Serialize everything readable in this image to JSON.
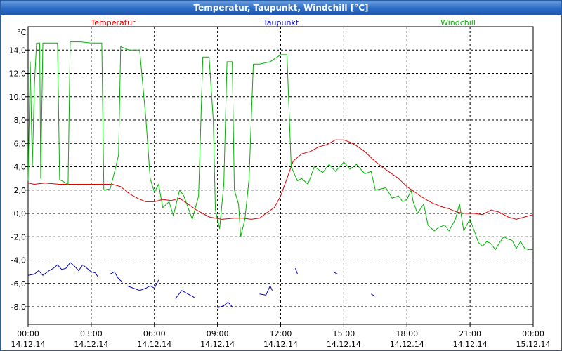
{
  "window": {
    "title": "Temperatur, Taupunkt, Windchill [°C]"
  },
  "colors": {
    "temperatur": "#e00000",
    "taupunkt": "#0000c0",
    "windchill": "#00b400",
    "grid": "#000000",
    "title_bar": "#2c6cc4"
  },
  "chart_data": {
    "type": "line",
    "title": "Temperatur, Taupunkt, Windchill [°C]",
    "unit_label": "°C",
    "ylim": [
      -9.5,
      16
    ],
    "xlim_hours": [
      0,
      24
    ],
    "grid": true,
    "legend_placement": "top",
    "y_ticks": [
      {
        "v": 14,
        "label": "14,0"
      },
      {
        "v": 12,
        "label": "12,0"
      },
      {
        "v": 10,
        "label": "10,0"
      },
      {
        "v": 8,
        "label": "8,0"
      },
      {
        "v": 6,
        "label": "6,0"
      },
      {
        "v": 4,
        "label": "4,0"
      },
      {
        "v": 2,
        "label": "2,0"
      },
      {
        "v": 0,
        "label": "0,0"
      },
      {
        "v": -2,
        "label": "-2,0"
      },
      {
        "v": -4,
        "label": "-4,0"
      },
      {
        "v": -6,
        "label": "-6,0"
      },
      {
        "v": -8,
        "label": "-8,0"
      }
    ],
    "x_ticks": [
      {
        "h": 0,
        "time": "00:00",
        "date": "14.12.14"
      },
      {
        "h": 3,
        "time": "03:00",
        "date": "14.12.14"
      },
      {
        "h": 6,
        "time": "06:00",
        "date": "14.12.14"
      },
      {
        "h": 9,
        "time": "09:00",
        "date": "14.12.14"
      },
      {
        "h": 12,
        "time": "12:00",
        "date": "14.12.14"
      },
      {
        "h": 15,
        "time": "15:00",
        "date": "14.12.14"
      },
      {
        "h": 18,
        "time": "18:00",
        "date": "14.12.14"
      },
      {
        "h": 21,
        "time": "21:00",
        "date": "14.12.14"
      },
      {
        "h": 24,
        "time": "00:00",
        "date": "15.12.14"
      }
    ],
    "series": [
      {
        "name": "Temperatur",
        "key": "temperatur",
        "segments": [
          [
            [
              0,
              2.6
            ],
            [
              0.3,
              2.5
            ],
            [
              0.8,
              2.6
            ],
            [
              1.5,
              2.5
            ],
            [
              2.5,
              2.5
            ],
            [
              3.5,
              2.5
            ],
            [
              4.0,
              2.5
            ],
            [
              4.4,
              2.3
            ],
            [
              4.8,
              1.7
            ],
            [
              5.2,
              1.3
            ],
            [
              5.6,
              1.0
            ],
            [
              6.0,
              1.0
            ],
            [
              6.4,
              1.2
            ],
            [
              6.8,
              1.1
            ],
            [
              7.2,
              1.3
            ],
            [
              7.6,
              0.8
            ],
            [
              8.0,
              0.3
            ],
            [
              8.6,
              -0.3
            ],
            [
              9.2,
              -0.5
            ],
            [
              9.8,
              -0.4
            ],
            [
              10.2,
              -0.4
            ],
            [
              10.6,
              -0.5
            ],
            [
              11.0,
              -0.4
            ],
            [
              11.3,
              0.0
            ],
            [
              11.7,
              0.5
            ],
            [
              12.0,
              1.5
            ],
            [
              12.3,
              3.0
            ],
            [
              12.6,
              4.5
            ],
            [
              13.0,
              5.1
            ],
            [
              13.4,
              5.3
            ],
            [
              13.8,
              5.7
            ],
            [
              14.2,
              5.9
            ],
            [
              14.6,
              6.3
            ],
            [
              15.0,
              6.3
            ],
            [
              15.3,
              6.1
            ],
            [
              15.6,
              5.8
            ],
            [
              16.0,
              5.3
            ],
            [
              16.4,
              4.6
            ],
            [
              16.8,
              4.0
            ],
            [
              17.2,
              3.5
            ],
            [
              17.6,
              3.0
            ],
            [
              18.0,
              2.3
            ],
            [
              18.4,
              1.8
            ],
            [
              18.8,
              1.3
            ],
            [
              19.2,
              0.9
            ],
            [
              19.6,
              0.6
            ],
            [
              20.0,
              0.4
            ],
            [
              20.4,
              0.1
            ],
            [
              20.8,
              0.0
            ],
            [
              21.2,
              0.0
            ],
            [
              21.6,
              -0.1
            ],
            [
              22.0,
              0.3
            ],
            [
              22.4,
              0.1
            ],
            [
              22.8,
              -0.3
            ],
            [
              23.2,
              -0.5
            ],
            [
              23.6,
              -0.3
            ],
            [
              24.0,
              -0.1
            ]
          ]
        ]
      },
      {
        "name": "Taupunkt",
        "key": "taupunkt",
        "segments": [
          [
            [
              0,
              -5.3
            ],
            [
              0.3,
              -5.2
            ],
            [
              0.5,
              -4.9
            ],
            [
              0.7,
              -5.3
            ],
            [
              1.0,
              -4.9
            ],
            [
              1.2,
              -4.7
            ],
            [
              1.4,
              -4.4
            ],
            [
              1.6,
              -4.8
            ],
            [
              1.8,
              -4.7
            ],
            [
              2.0,
              -4.2
            ],
            [
              2.2,
              -4.5
            ],
            [
              2.4,
              -4.9
            ],
            [
              2.6,
              -4.4
            ],
            [
              2.8,
              -4.7
            ],
            [
              3.0,
              -5.0
            ],
            [
              3.2,
              -5.1
            ],
            [
              3.3,
              -5.4
            ]
          ],
          [
            [
              3.9,
              -5.2
            ],
            [
              4.1,
              -5.0
            ],
            [
              4.3,
              -5.6
            ],
            [
              4.5,
              -5.9
            ]
          ],
          [
            [
              4.7,
              -6.2
            ],
            [
              5.0,
              -6.4
            ],
            [
              5.3,
              -6.6
            ],
            [
              5.6,
              -6.4
            ],
            [
              5.8,
              -6.2
            ],
            [
              6.0,
              -6.4
            ],
            [
              6.2,
              -5.7
            ]
          ],
          [
            [
              7.0,
              -7.3
            ],
            [
              7.3,
              -6.6
            ],
            [
              7.6,
              -6.9
            ],
            [
              7.9,
              -7.2
            ]
          ],
          [
            [
              9.0,
              -8.1
            ],
            [
              9.3,
              -7.9
            ],
            [
              9.5,
              -7.6
            ],
            [
              9.7,
              -8.0
            ]
          ],
          [
            [
              11.0,
              -6.9
            ],
            [
              11.3,
              -7.0
            ],
            [
              11.5,
              -6.2
            ],
            [
              11.6,
              -6.6
            ]
          ],
          [
            [
              12.7,
              -4.7
            ],
            [
              12.8,
              -5.2
            ]
          ],
          [
            [
              14.5,
              -5.0
            ],
            [
              14.7,
              -5.2
            ]
          ],
          [
            [
              16.3,
              -6.9
            ],
            [
              16.5,
              -7.1
            ]
          ]
        ]
      },
      {
        "name": "Windchill",
        "key": "windchill",
        "segments": [
          [
            [
              0,
              2.8
            ],
            [
              0.1,
              13.0
            ],
            [
              0.2,
              4.0
            ],
            [
              0.3,
              11.0
            ],
            [
              0.4,
              14.6
            ],
            [
              0.55,
              14.6
            ],
            [
              0.6,
              3.0
            ],
            [
              0.7,
              14.6
            ],
            [
              1.4,
              14.6
            ],
            [
              1.5,
              2.9
            ],
            [
              1.9,
              2.5
            ],
            [
              2.0,
              14.7
            ],
            [
              2.5,
              14.7
            ],
            [
              3.0,
              14.6
            ],
            [
              3.5,
              14.6
            ],
            [
              3.6,
              2.0
            ],
            [
              3.9,
              2.1
            ],
            [
              4.1,
              3.5
            ],
            [
              4.3,
              5.0
            ],
            [
              4.4,
              14.3
            ],
            [
              4.8,
              14.0
            ],
            [
              5.3,
              14.0
            ],
            [
              5.6,
              8.0
            ],
            [
              5.8,
              3.0
            ],
            [
              6.0,
              1.8
            ],
            [
              6.2,
              2.5
            ],
            [
              6.4,
              0.5
            ],
            [
              6.7,
              1.0
            ],
            [
              6.9,
              -0.2
            ],
            [
              7.2,
              2.0
            ],
            [
              7.4,
              1.5
            ],
            [
              7.6,
              0.5
            ],
            [
              7.8,
              -0.5
            ],
            [
              8.1,
              1.5
            ],
            [
              8.3,
              13.4
            ],
            [
              8.6,
              13.4
            ],
            [
              8.8,
              8.0
            ],
            [
              8.9,
              0.3
            ],
            [
              9.1,
              -1.3
            ],
            [
              9.3,
              2.5
            ],
            [
              9.45,
              13.0
            ],
            [
              9.7,
              13.0
            ],
            [
              9.8,
              2.0
            ],
            [
              10.0,
              0.8
            ],
            [
              10.1,
              -2.0
            ],
            [
              10.3,
              -0.5
            ],
            [
              10.5,
              3.0
            ],
            [
              10.7,
              12.8
            ],
            [
              11.0,
              12.8
            ],
            [
              11.5,
              13.0
            ],
            [
              12.0,
              13.6
            ],
            [
              12.3,
              13.6
            ],
            [
              12.5,
              4.0
            ],
            [
              12.8,
              2.8
            ],
            [
              13.0,
              3.0
            ],
            [
              13.3,
              2.5
            ],
            [
              13.6,
              4.0
            ],
            [
              14.0,
              3.5
            ],
            [
              14.3,
              4.2
            ],
            [
              14.6,
              3.6
            ],
            [
              15.0,
              4.4
            ],
            [
              15.3,
              3.8
            ],
            [
              15.6,
              4.2
            ],
            [
              16.0,
              3.4
            ],
            [
              16.3,
              3.6
            ],
            [
              16.5,
              2.0
            ],
            [
              17.0,
              2.2
            ],
            [
              17.3,
              1.3
            ],
            [
              17.6,
              1.5
            ],
            [
              17.8,
              1.0
            ],
            [
              18.0,
              1.2
            ],
            [
              18.2,
              2.0
            ],
            [
              18.3,
              1.0
            ],
            [
              18.5,
              0.0
            ],
            [
              18.8,
              0.8
            ],
            [
              19.0,
              -1.0
            ],
            [
              19.3,
              -1.5
            ],
            [
              19.5,
              -1.2
            ],
            [
              19.8,
              -1.0
            ],
            [
              20.0,
              -1.5
            ],
            [
              20.3,
              -0.5
            ],
            [
              20.5,
              0.8
            ],
            [
              20.7,
              -1.5
            ],
            [
              20.9,
              -0.8
            ],
            [
              21.0,
              -0.5
            ],
            [
              21.2,
              -1.5
            ],
            [
              21.4,
              -2.5
            ],
            [
              21.6,
              -2.8
            ],
            [
              21.8,
              -2.4
            ],
            [
              22.0,
              -2.6
            ],
            [
              22.2,
              -3.1
            ],
            [
              22.4,
              -2.5
            ],
            [
              22.6,
              -2.0
            ],
            [
              22.8,
              -2.2
            ],
            [
              23.0,
              -2.3
            ],
            [
              23.2,
              -3.0
            ],
            [
              23.4,
              -2.4
            ],
            [
              23.6,
              -3.0
            ],
            [
              23.8,
              -3.1
            ],
            [
              24.0,
              -3.1
            ]
          ]
        ]
      }
    ]
  }
}
